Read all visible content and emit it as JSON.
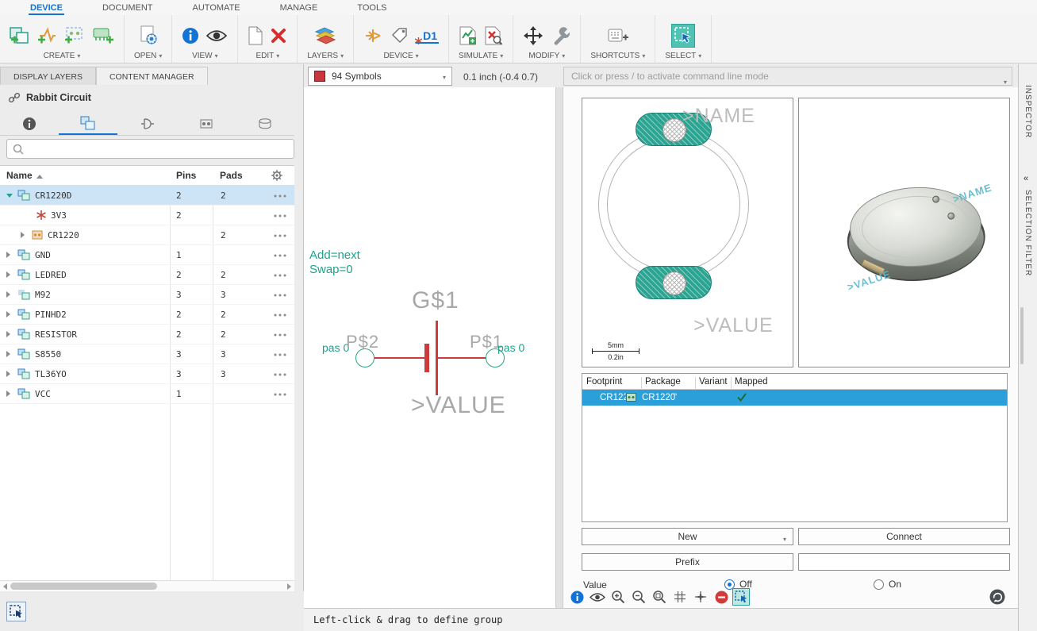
{
  "menubar": {
    "items": [
      {
        "label": "DEVICE"
      },
      {
        "label": "DOCUMENT"
      },
      {
        "label": "AUTOMATE"
      },
      {
        "label": "MANAGE"
      },
      {
        "label": "TOOLS"
      }
    ]
  },
  "toolbar": {
    "groups": [
      {
        "label": "CREATE"
      },
      {
        "label": "OPEN"
      },
      {
        "label": "VIEW"
      },
      {
        "label": "EDIT"
      },
      {
        "label": "LAYERS"
      },
      {
        "label": "DEVICE"
      },
      {
        "label": "SIMULATE"
      },
      {
        "label": "MODIFY"
      },
      {
        "label": "SHORTCUTS"
      },
      {
        "label": "SELECT"
      }
    ],
    "device_icon_label": "D1"
  },
  "left_panel": {
    "tabs": [
      {
        "label": "DISPLAY LAYERS"
      },
      {
        "label": "CONTENT MANAGER"
      }
    ],
    "library_name": "Rabbit Circuit",
    "table": {
      "header": {
        "name": "Name",
        "pins": "Pins",
        "pads": "Pads"
      },
      "rows": [
        {
          "name": "CR1220D",
          "pins": "2",
          "pads": "2"
        },
        {
          "name": "3V3",
          "pins": "2",
          "pads": ""
        },
        {
          "name": "CR1220",
          "pins": "",
          "pads": "2"
        },
        {
          "name": "GND",
          "pins": "1",
          "pads": ""
        },
        {
          "name": "LEDRED",
          "pins": "2",
          "pads": "2"
        },
        {
          "name": "M92",
          "pins": "3",
          "pads": "3"
        },
        {
          "name": "PINHD2",
          "pins": "2",
          "pads": "2"
        },
        {
          "name": "RESISTOR",
          "pins": "2",
          "pads": "2"
        },
        {
          "name": "S8550",
          "pins": "3",
          "pads": "3"
        },
        {
          "name": "TL36YO",
          "pins": "3",
          "pads": "3"
        },
        {
          "name": "VCC",
          "pins": "1",
          "pads": ""
        }
      ]
    }
  },
  "toolbar2": {
    "symbol_selector": "94 Symbols",
    "coords": "0.1 inch (-0.4 0.7)",
    "command_placeholder": "Click or press / to activate command line mode"
  },
  "canvas": {
    "add_label": "Add=next",
    "swap_label": "Swap=0",
    "gate_label": "G$1",
    "pin_left": "P$2",
    "pin_right": "P$1",
    "pas_left": "pas 0",
    "pas_right": "pas 0",
    "value_label": ">VALUE"
  },
  "status_bar": {
    "text": "Left-click & drag to define group"
  },
  "preview": {
    "name_label": ">NAME",
    "value_label": ">VALUE",
    "scale_top": "5mm",
    "scale_bottom": "0.2in",
    "view3d": {
      "name_label": ">NAME",
      "value_label": ">VALUE"
    }
  },
  "mapping": {
    "columns": [
      {
        "label": "Footprint"
      },
      {
        "label": "Package"
      },
      {
        "label": "Variant"
      },
      {
        "label": "Mapped"
      }
    ],
    "row": {
      "footprint": "CR1220",
      "package": "CR1220",
      "variant": "\""
    }
  },
  "actions": {
    "new": "New",
    "connect": "Connect",
    "prefix": "Prefix",
    "value_label": "Value",
    "off": "Off",
    "on": "On"
  },
  "right_strip": {
    "inspector": "INSPECTOR",
    "selection_filter": "SELECTION FILTER"
  },
  "colors": {
    "accent_teal": "#2a9d8f",
    "accent_blue": "#1273d4",
    "symbol_red": "#cc3b3b",
    "selected_row_blue": "#2b9fd9"
  }
}
